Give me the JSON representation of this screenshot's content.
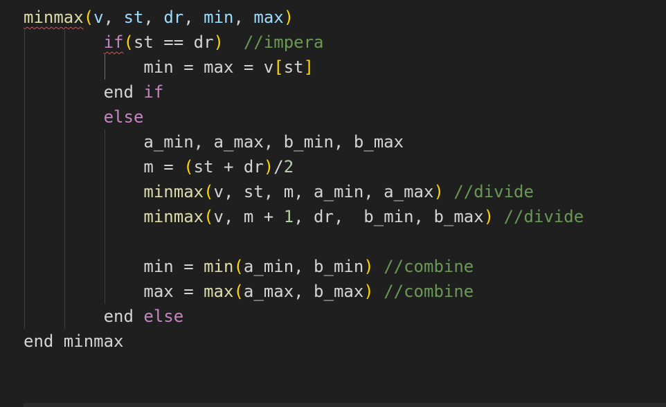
{
  "editor": {
    "lines": [
      [
        {
          "t": "minmax",
          "c": "fn",
          "squiggle": true
        },
        {
          "t": "(",
          "c": "br"
        },
        {
          "t": "v",
          "c": "var"
        },
        {
          "t": ", ",
          "c": "pl"
        },
        {
          "t": "st",
          "c": "var"
        },
        {
          "t": ", ",
          "c": "pl"
        },
        {
          "t": "dr",
          "c": "var"
        },
        {
          "t": ", ",
          "c": "pl"
        },
        {
          "t": "min",
          "c": "var"
        },
        {
          "t": ", ",
          "c": "pl"
        },
        {
          "t": "max",
          "c": "var"
        },
        {
          "t": ")",
          "c": "br"
        }
      ],
      [
        {
          "t": "        ",
          "c": "pl"
        },
        {
          "t": "if",
          "c": "kw",
          "squiggle": true
        },
        {
          "t": "(",
          "c": "br"
        },
        {
          "t": "st == dr",
          "c": "pl"
        },
        {
          "t": ")",
          "c": "br"
        },
        {
          "t": "  ",
          "c": "pl"
        },
        {
          "t": "//impera",
          "c": "cmt"
        }
      ],
      [
        {
          "t": "            min = max = v",
          "c": "pl"
        },
        {
          "t": "[",
          "c": "br"
        },
        {
          "t": "st",
          "c": "pl"
        },
        {
          "t": "]",
          "c": "br"
        }
      ],
      [
        {
          "t": "        end ",
          "c": "pl"
        },
        {
          "t": "if",
          "c": "kw"
        }
      ],
      [
        {
          "t": "        ",
          "c": "pl"
        },
        {
          "t": "else",
          "c": "kw"
        }
      ],
      [
        {
          "t": "            a_min, a_max, b_min, b_max",
          "c": "pl"
        }
      ],
      [
        {
          "t": "            m = ",
          "c": "pl"
        },
        {
          "t": "(",
          "c": "br"
        },
        {
          "t": "st + dr",
          "c": "pl"
        },
        {
          "t": ")",
          "c": "br"
        },
        {
          "t": "/",
          "c": "pl"
        },
        {
          "t": "2",
          "c": "num"
        }
      ],
      [
        {
          "t": "            ",
          "c": "pl"
        },
        {
          "t": "minmax",
          "c": "fn"
        },
        {
          "t": "(",
          "c": "br"
        },
        {
          "t": "v, st, m, a_min, a_max",
          "c": "pl"
        },
        {
          "t": ")",
          "c": "br"
        },
        {
          "t": " ",
          "c": "pl"
        },
        {
          "t": "//divide",
          "c": "cmt"
        }
      ],
      [
        {
          "t": "            ",
          "c": "pl"
        },
        {
          "t": "minmax",
          "c": "fn"
        },
        {
          "t": "(",
          "c": "br"
        },
        {
          "t": "v, m + ",
          "c": "pl"
        },
        {
          "t": "1",
          "c": "num"
        },
        {
          "t": ", dr,  b_min, b_max",
          "c": "pl"
        },
        {
          "t": ")",
          "c": "br"
        },
        {
          "t": " ",
          "c": "pl"
        },
        {
          "t": "//divide",
          "c": "cmt"
        }
      ],
      [],
      [
        {
          "t": "            min = ",
          "c": "pl"
        },
        {
          "t": "min",
          "c": "fn"
        },
        {
          "t": "(",
          "c": "br"
        },
        {
          "t": "a_min, b_min",
          "c": "pl"
        },
        {
          "t": ")",
          "c": "br"
        },
        {
          "t": " ",
          "c": "pl"
        },
        {
          "t": "//combine",
          "c": "cmt"
        }
      ],
      [
        {
          "t": "            max = ",
          "c": "pl"
        },
        {
          "t": "max",
          "c": "fn"
        },
        {
          "t": "(",
          "c": "br"
        },
        {
          "t": "a_max, b_max",
          "c": "pl"
        },
        {
          "t": ")",
          "c": "br"
        },
        {
          "t": " ",
          "c": "pl"
        },
        {
          "t": "//combine",
          "c": "cmt"
        }
      ],
      [
        {
          "t": "        end ",
          "c": "pl"
        },
        {
          "t": "else",
          "c": "kw"
        }
      ],
      [
        {
          "t": "end minmax",
          "c": "pl"
        }
      ]
    ]
  },
  "colors": {
    "background": "#1f1f1f",
    "function": "#dcdcaa",
    "variable": "#9cdcfe",
    "keyword": "#c586c0",
    "comment": "#6a9955",
    "number": "#b5cea8",
    "bracket": "#ffd700",
    "plain": "#d4d4d4",
    "error_squiggle": "#f14c4c"
  }
}
